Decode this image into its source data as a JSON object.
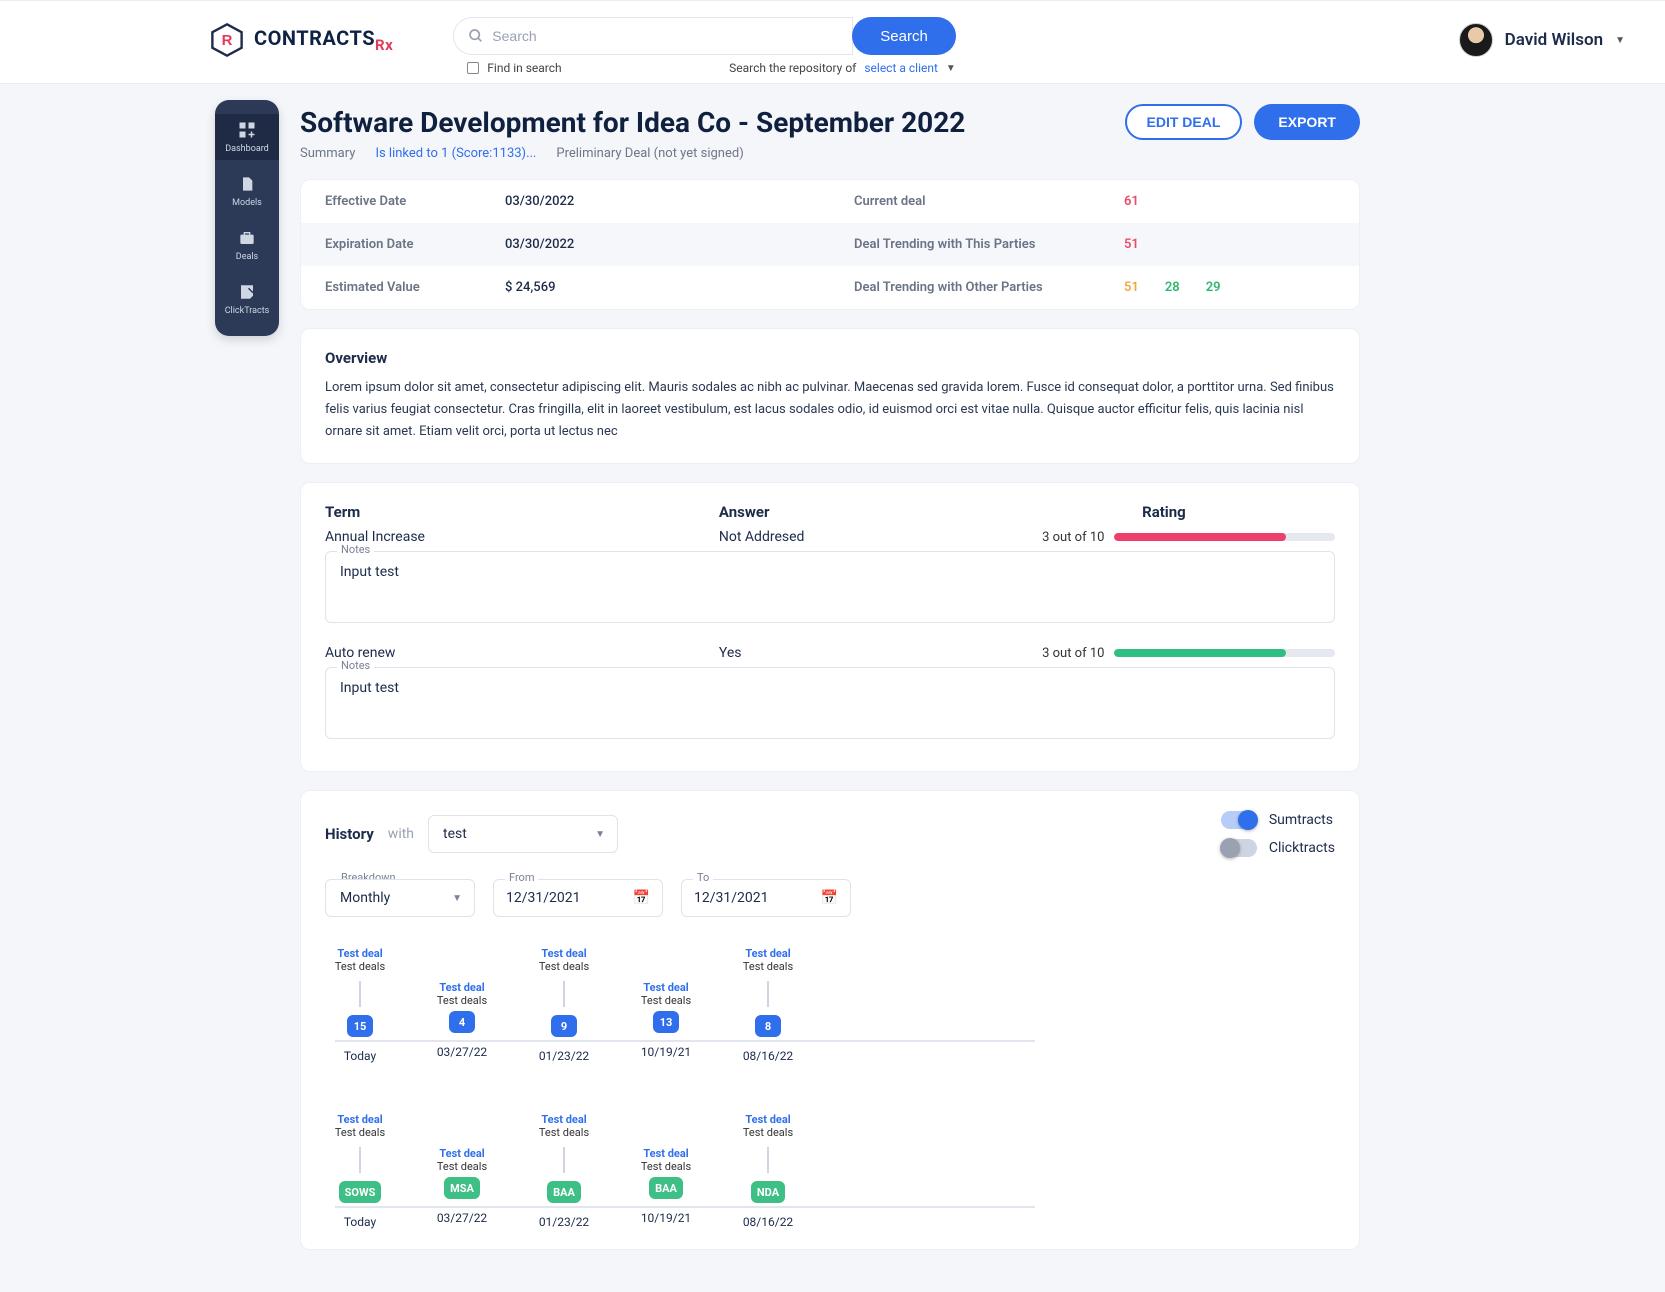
{
  "brand": {
    "name": "CONTRACTS",
    "suffix": "Rx"
  },
  "search": {
    "placeholder": "Search",
    "button": "Search",
    "find": "Find in search",
    "repo_prefix": "Search the repository of",
    "client": "select a client"
  },
  "user": {
    "name": "David Wilson"
  },
  "sidebar": {
    "items": [
      {
        "label": "Dashboard"
      },
      {
        "label": "Models"
      },
      {
        "label": "Deals"
      },
      {
        "label": "ClickTracts"
      }
    ]
  },
  "page": {
    "title": "Software Development for Idea Co - September 2022",
    "edit": "EDIT DEAL",
    "export": "EXPORT",
    "summary": "Summary",
    "linked": "Is linked to 1 (Score:1133)...",
    "status": "Preliminary Deal (not yet signed)"
  },
  "meta": {
    "effective_label": "Effective Date",
    "effective": "03/30/2022",
    "expiration_label": "Expiration Date",
    "expiration": "03/30/2022",
    "estval_label": "Estimated Value",
    "estval": "$ 24,569",
    "current_label": "Current deal",
    "current": "61",
    "trend_this_label": "Deal Trending with This Parties",
    "trend_this": "51",
    "trend_other_label": "Deal Trending with Other Parties",
    "trend_other_a": "51",
    "trend_other_b": "28",
    "trend_other_c": "29"
  },
  "overview": {
    "heading": "Overview",
    "body": "Lorem ipsum dolor sit amet, consectetur adipiscing elit. Mauris sodales ac nibh ac pulvinar. Maecenas sed gravida lorem. Fusce id consequat dolor, a porttitor urna. Sed finibus felis varius feugiat consectetur. Cras fringilla, elit in laoreet vestibulum, est lacus sodales odio, id euismod orci est vitae nulla. Quisque auctor efficitur felis, quis lacinia nisl ornare sit amet. Etiam velit orci, porta ut lectus nec"
  },
  "terms": {
    "h_term": "Term",
    "h_answer": "Answer",
    "h_rating": "Rating",
    "notes_label": "Notes",
    "rows": [
      {
        "term": "Annual Increase",
        "answer": "Not Addresed",
        "rating": "3 out of 10",
        "pct": 78,
        "color": "pink",
        "notes": "Input test"
      },
      {
        "term": "Auto renew",
        "answer": "Yes",
        "rating": "3 out of 10",
        "pct": 78,
        "color": "green",
        "notes": "Input test"
      }
    ]
  },
  "history": {
    "heading": "History",
    "with": "with",
    "filter": "test",
    "toggle_sum": "Sumtracts",
    "toggle_click": "Clicktracts",
    "breakdown_label": "Breakdown",
    "breakdown": "Monthly",
    "from_label": "From",
    "from": "12/31/2021",
    "to_label": "To",
    "to": "12/31/2021",
    "timeline1": [
      {
        "title": "Test deal",
        "sub": "Test deals",
        "node": "15",
        "date": "Today"
      },
      {
        "title": "Test deal",
        "sub": "Test deals",
        "node": "4",
        "date": "03/27/22"
      },
      {
        "title": "Test deal",
        "sub": "Test deals",
        "node": "9",
        "date": "01/23/22"
      },
      {
        "title": "Test deal",
        "sub": "Test deals",
        "node": "13",
        "date": "10/19/21"
      },
      {
        "title": "Test deal",
        "sub": "Test deals",
        "node": "8",
        "date": "08/16/22"
      }
    ],
    "timeline2": [
      {
        "title": "Test deal",
        "sub": "Test deals",
        "node": "SOWS",
        "date": "Today"
      },
      {
        "title": "Test deal",
        "sub": "Test deals",
        "node": "MSA",
        "date": "03/27/22"
      },
      {
        "title": "Test deal",
        "sub": "Test deals",
        "node": "BAA",
        "date": "01/23/22"
      },
      {
        "title": "Test deal",
        "sub": "Test deals",
        "node": "BAA",
        "date": "10/19/21"
      },
      {
        "title": "Test deal",
        "sub": "Test deals",
        "node": "NDA",
        "date": "08/16/22"
      }
    ]
  }
}
